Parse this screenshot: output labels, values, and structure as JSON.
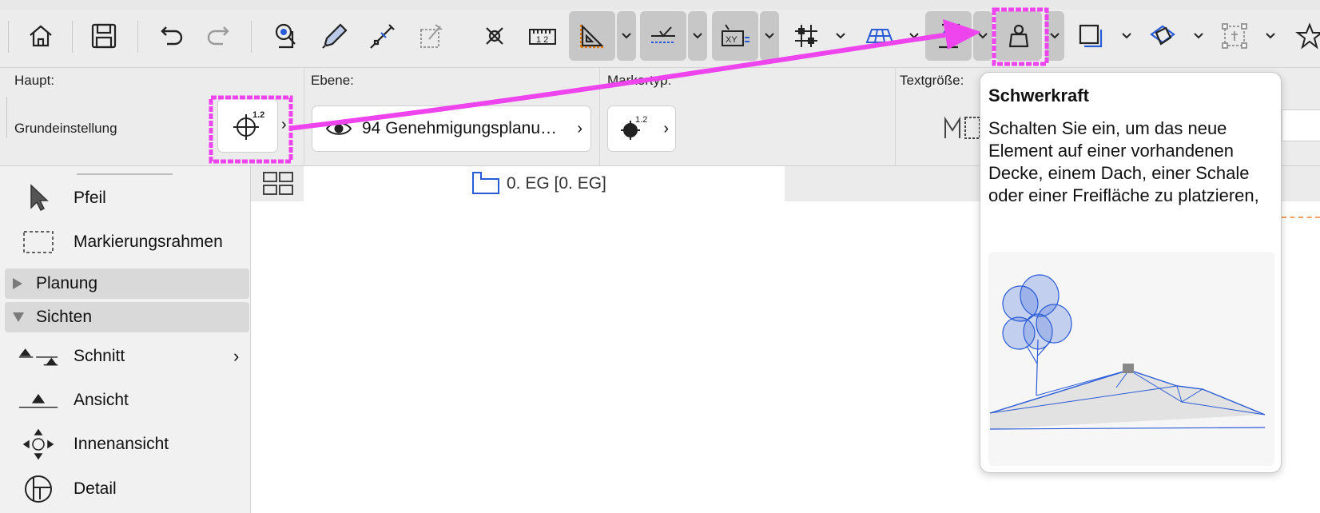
{
  "infobar": {
    "main_label": "Haupt:",
    "preset_label": "Grundeinstellung",
    "layer_label": "Ebene:",
    "layer_value": "94 Genehmigungsplanu…",
    "marker_label": "Markertyp:",
    "textsize_label": "Textgröße:",
    "symbol_badge": "1.2",
    "marker_badge": "1.2"
  },
  "view": {
    "floor_tab": "0. EG [0. EG]"
  },
  "sidebar": {
    "items": [
      {
        "label": "Pfeil",
        "icon": "arrow-pointer-icon"
      },
      {
        "label": "Markierungsrahmen",
        "icon": "marquee-icon"
      }
    ],
    "groups": [
      {
        "label": "Planung",
        "expanded": false
      },
      {
        "label": "Sichten",
        "expanded": true
      }
    ],
    "view_items": [
      {
        "label": "Schnitt",
        "icon": "section-icon",
        "has_submenu": true
      },
      {
        "label": "Ansicht",
        "icon": "elevation-icon",
        "has_submenu": false
      },
      {
        "label": "Innenansicht",
        "icon": "interior-elevation-icon",
        "has_submenu": false
      },
      {
        "label": "Detail",
        "icon": "detail-icon",
        "has_submenu": false
      }
    ]
  },
  "tooltip": {
    "title": "Schwerkraft",
    "body": "Schalten Sie ein, um das neue Element auf einer vorhandenen Decke, einem Dach, einer Schale oder einer Freifläche zu platzieren,"
  },
  "colors": {
    "accent_blue": "#2a5bd7",
    "annotation_magenta": "#ee44ee",
    "toolbar_bg": "#ececec",
    "active_tool_bg": "#c7c7c7"
  }
}
